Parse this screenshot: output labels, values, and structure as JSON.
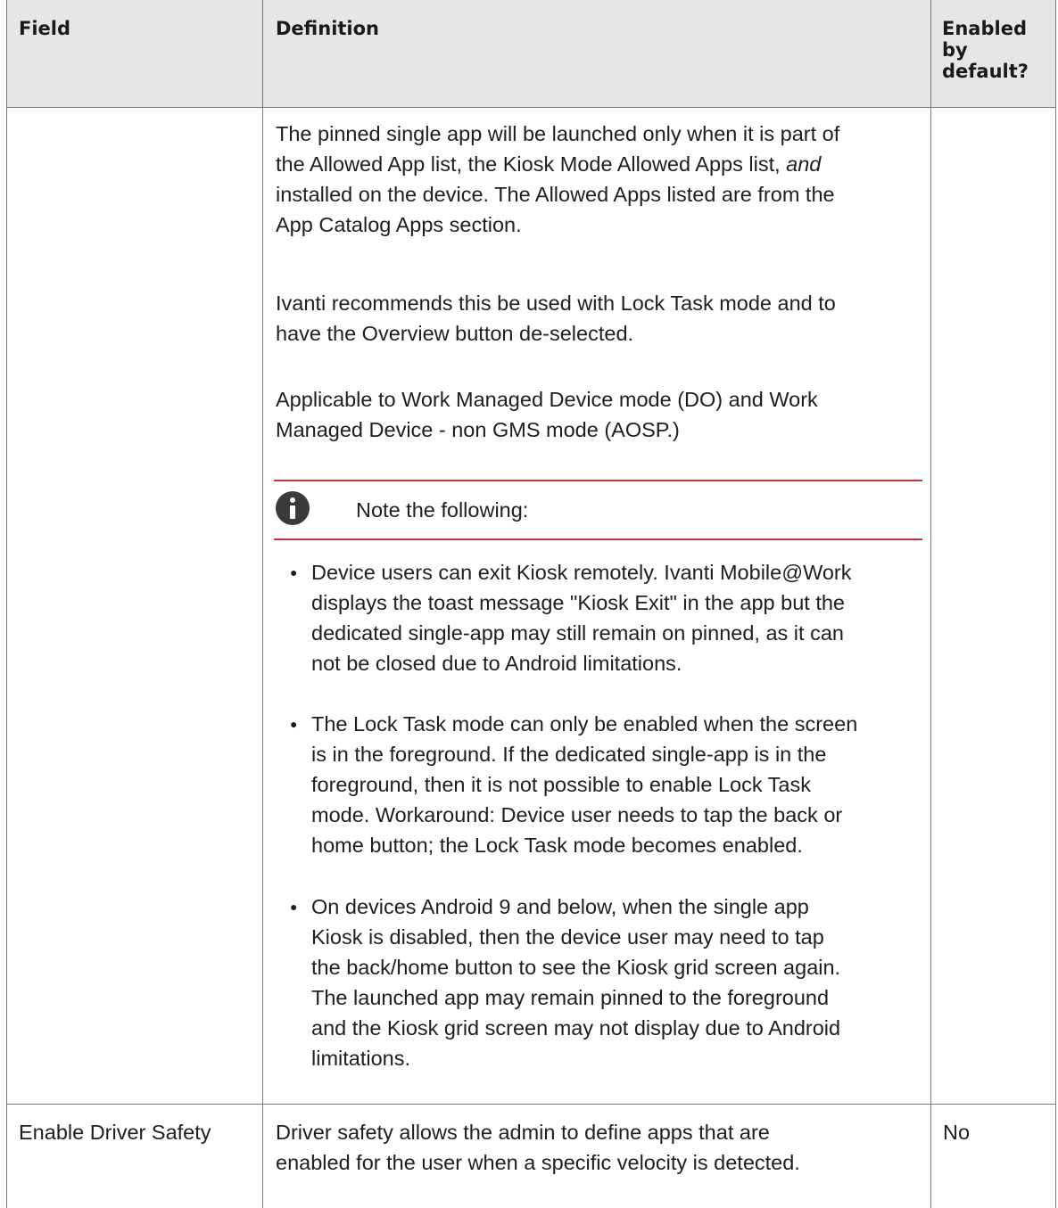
{
  "header": {
    "field": "Field",
    "definition": "Definition",
    "enabled_line1": "Enabled",
    "enabled_line2": "by",
    "enabled_line3": "default?"
  },
  "row1": {
    "para1": {
      "line1": "The pinned single app will be launched only when it is part of",
      "line2a": "the Allowed App list, the Kiosk Mode Allowed Apps list, ",
      "line2_italic": "and",
      "line3": "installed on the device. The Allowed Apps listed are from the",
      "line4": "App Catalog Apps section."
    },
    "para2": {
      "line1": "Ivanti recommends this be used with Lock Task mode and to",
      "line2": "have the Overview button de-selected."
    },
    "para3": {
      "line1": "Applicable to Work Managed Device mode (DO) and Work",
      "line2": "Managed Device - non GMS mode (AOSP.)"
    },
    "note": {
      "title": "Note the following:",
      "bullets": [
        {
          "lines": [
            "Device users can exit Kiosk remotely. Ivanti Mobile@Work",
            "displays the toast message \"Kiosk Exit\" in the app but the",
            "dedicated single-app may still remain on pinned, as it can",
            "not be closed due to Android limitations."
          ]
        },
        {
          "lines": [
            "The Lock Task mode can only be enabled when the screen",
            "is in the foreground. If the dedicated single-app is in the",
            "foreground, then it is not possible to enable Lock Task",
            "mode. Workaround: Device user needs to tap the back or",
            "home button; the Lock Task mode becomes enabled."
          ]
        },
        {
          "lines": [
            "On devices Android 9 and below, when the single app",
            "Kiosk is disabled, then the device user may need to tap",
            "the back/home button to see the Kiosk grid screen again.",
            "The launched app may remain pinned to the foreground",
            "and the Kiosk grid screen may not display due to Android",
            "limitations."
          ]
        }
      ]
    }
  },
  "row2": {
    "field": "Enable Driver Safety",
    "definition_line1": "Driver safety allows the admin to define apps that are",
    "definition_line2": "enabled for the user when a specific velocity is detected.",
    "enabled": "No"
  }
}
